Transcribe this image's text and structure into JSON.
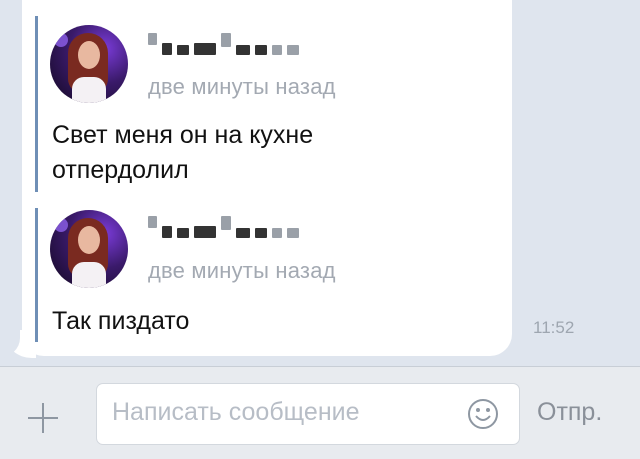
{
  "messages": [
    {
      "time_label": "две минуты назад",
      "text_lines": [
        "Свет меня он на кухне",
        "отпердолил"
      ]
    },
    {
      "time_label": "две минуты назад",
      "text_lines": [
        "Так пиздато"
      ]
    }
  ],
  "timestamp": "11:52",
  "composer": {
    "placeholder": "Написать сообщение",
    "send_label": "Отпр."
  },
  "colors": {
    "background": "#dfe5ee",
    "bubble": "#ffffff",
    "forward_bar": "#6f8fb6",
    "muted_text": "#a3a9b2"
  },
  "icons": [
    "attach-plus-icon",
    "smiley-icon"
  ]
}
